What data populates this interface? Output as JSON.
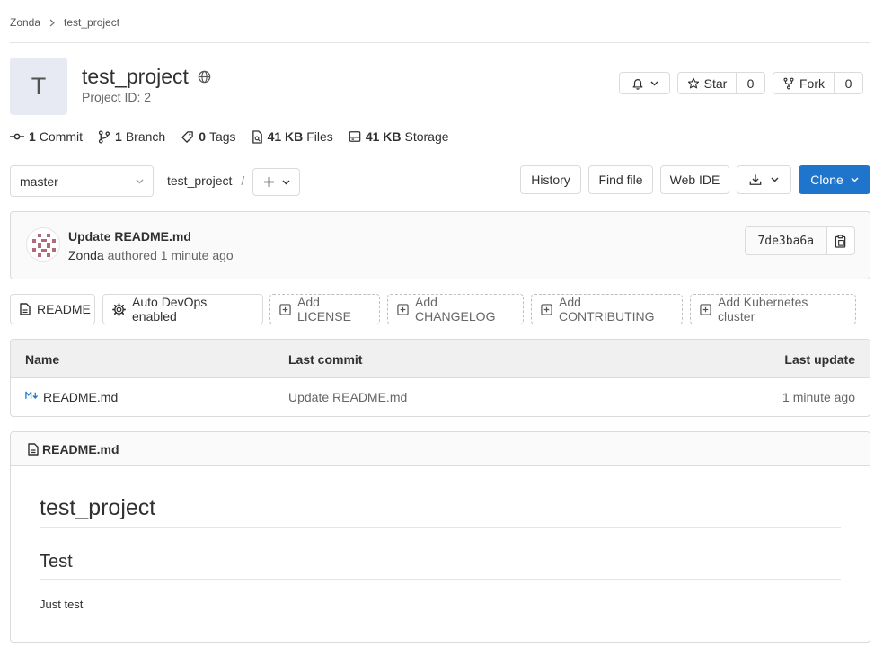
{
  "breadcrumb": {
    "group": "Zonda",
    "project": "test_project"
  },
  "project": {
    "avatar_letter": "T",
    "name": "test_project",
    "id_label": "Project ID: 2"
  },
  "actions": {
    "star_label": "Star",
    "star_count": "0",
    "fork_label": "Fork",
    "fork_count": "0"
  },
  "stats": {
    "commits_count": "1",
    "commits_label": "Commit",
    "branches_count": "1",
    "branches_label": "Branch",
    "tags_count": "0",
    "tags_label": "Tags",
    "files_size": "41 KB",
    "files_label": "Files",
    "storage_size": "41 KB",
    "storage_label": "Storage"
  },
  "tree": {
    "branch": "master",
    "path": "test_project",
    "path_sep": "/",
    "history_label": "History",
    "find_file_label": "Find file",
    "web_ide_label": "Web IDE",
    "clone_label": "Clone"
  },
  "last_commit": {
    "title": "Update README.md",
    "author": "Zonda",
    "action": "authored",
    "time": "1 minute ago",
    "sha": "7de3ba6a"
  },
  "shortcuts": {
    "readme": "README",
    "auto_devops": "Auto DevOps enabled",
    "add_license": "Add LICENSE",
    "add_changelog": "Add CHANGELOG",
    "add_contributing": "Add CONTRIBUTING",
    "add_k8s": "Add Kubernetes cluster"
  },
  "table": {
    "headers": {
      "name": "Name",
      "last_commit": "Last commit",
      "last_update": "Last update"
    },
    "rows": [
      {
        "name": "README.md",
        "commit": "Update README.md",
        "updated": "1 minute ago"
      }
    ]
  },
  "readme": {
    "filename": "README.md",
    "h1": "test_project",
    "h2": "Test",
    "body": "Just test"
  },
  "colors": {
    "primary": "#1f75cb",
    "link": "#303030",
    "muted": "#666666",
    "markdown_icon": "#1f78d1"
  }
}
